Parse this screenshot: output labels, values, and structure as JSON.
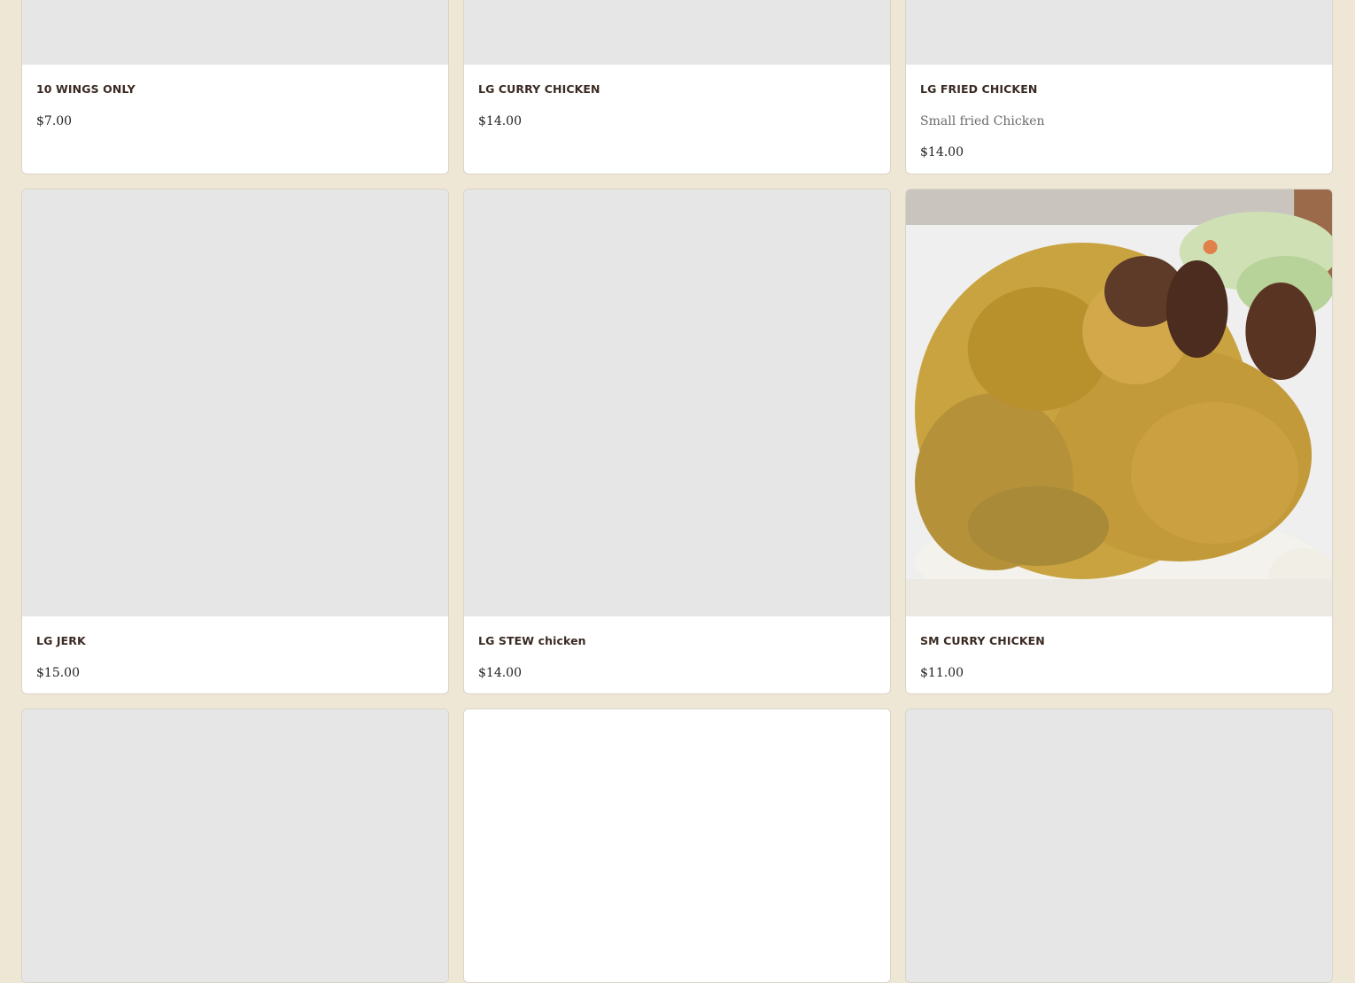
{
  "menu": {
    "items": [
      {
        "name": "10 WINGS ONLY",
        "description": "",
        "price": "$7.00",
        "has_image": false
      },
      {
        "name": "LG CURRY CHICKEN",
        "description": "",
        "price": "$14.00",
        "has_image": false
      },
      {
        "name": "LG FRIED CHICKEN",
        "description": "Small fried Chicken",
        "price": "$14.00",
        "has_image": false
      },
      {
        "name": "LG JERK",
        "description": "",
        "price": "$15.00",
        "has_image": false
      },
      {
        "name": "LG STEW chicken",
        "description": "",
        "price": "$14.00",
        "has_image": false
      },
      {
        "name": "SM CURRY CHICKEN",
        "description": "",
        "price": "$11.00",
        "has_image": true
      }
    ]
  },
  "colors": {
    "page_background": "#efe7d6",
    "card_background": "#ffffff",
    "image_placeholder": "#e6e6e6",
    "title_text": "#3a2a22"
  }
}
